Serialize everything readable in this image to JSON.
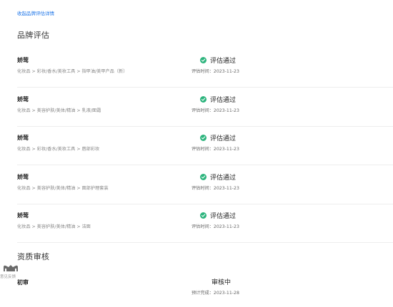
{
  "header": {
    "collapse_link": "收起品牌评估详情"
  },
  "brand_evaluation": {
    "title": "品牌评估",
    "status_color": "#2db47d",
    "rows": [
      {
        "brand": "娇莺",
        "category_path": "化妆品 > 彩妆/香水/美妆工具 > 指甲油/美甲产品（新）",
        "status": "评估通过",
        "time": "评估时间：2023-11-23"
      },
      {
        "brand": "娇莺",
        "category_path": "化妆品 > 美容护肤/美体/精油 > 乳液/面霜",
        "status": "评估通过",
        "time": "评估时间：2023-11-23"
      },
      {
        "brand": "娇莺",
        "category_path": "化妆品 > 彩妆/香水/美妆工具 > 唇部彩妆",
        "status": "评估通过",
        "time": "评估时间：2023-11-23"
      },
      {
        "brand": "娇莺",
        "category_path": "化妆品 > 美容护肤/美体/精油 > 面部护理套装",
        "status": "评估通过",
        "time": "评估时间：2023-11-23"
      },
      {
        "brand": "娇莺",
        "category_path": "化妆品 > 美容护肤/美体/精油 > 洁面",
        "status": "评估通过",
        "time": "评估时间：2023-11-23"
      }
    ]
  },
  "qualification_review": {
    "title": "资质审核",
    "stage": "初审",
    "status": "审核中",
    "expected": "预计完成：2023-11-28"
  },
  "feedback": {
    "label": "意见反馈"
  }
}
